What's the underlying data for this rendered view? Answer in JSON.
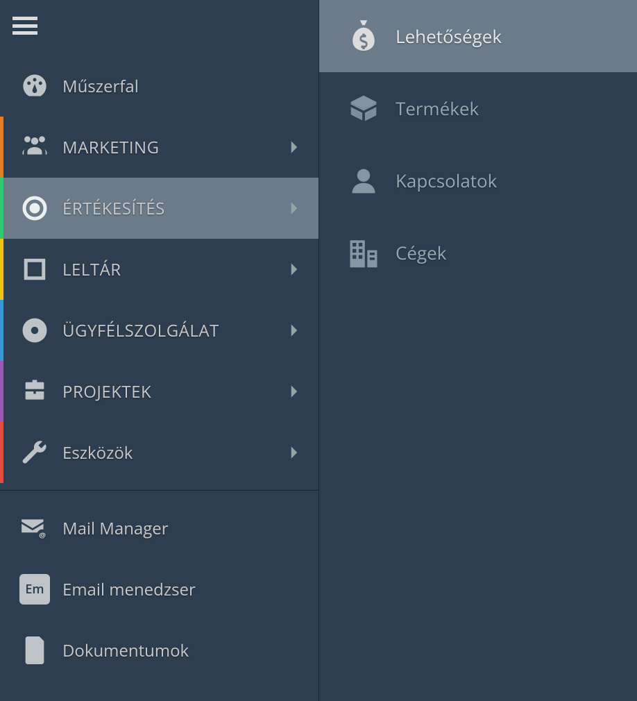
{
  "sidebar": {
    "items": [
      {
        "label": "Műszerfal",
        "icon": "dashboard",
        "expandable": false
      },
      {
        "label": "MARKETING",
        "icon": "users",
        "expandable": true,
        "accent": "orange"
      },
      {
        "label": "ÉRTÉKESÍTÉS",
        "icon": "target",
        "expandable": true,
        "accent": "green",
        "active": true
      },
      {
        "label": "LELTÁR",
        "icon": "square",
        "expandable": true,
        "accent": "yellow"
      },
      {
        "label": "ÜGYFÉLSZOLGÁLAT",
        "icon": "lifebuoy",
        "expandable": true,
        "accent": "blue"
      },
      {
        "label": "PROJEKTEK",
        "icon": "briefcase",
        "expandable": true,
        "accent": "purple"
      },
      {
        "label": "Eszközök",
        "icon": "wrench",
        "expandable": true,
        "accent": "darkorange"
      }
    ],
    "footer_items": [
      {
        "label": "Mail Manager",
        "icon": "mail-at"
      },
      {
        "label": "Email menedzser",
        "icon": "em-badge"
      },
      {
        "label": "Dokumentumok",
        "icon": "document"
      }
    ]
  },
  "submenu": {
    "items": [
      {
        "label": "Lehetőségek",
        "icon": "moneybag",
        "active": true
      },
      {
        "label": "Termékek",
        "icon": "box",
        "active": false
      },
      {
        "label": "Kapcsolatok",
        "icon": "person",
        "active": false
      },
      {
        "label": "Cégek",
        "icon": "buildings",
        "active": false
      }
    ]
  },
  "em_badge_text": "Em"
}
